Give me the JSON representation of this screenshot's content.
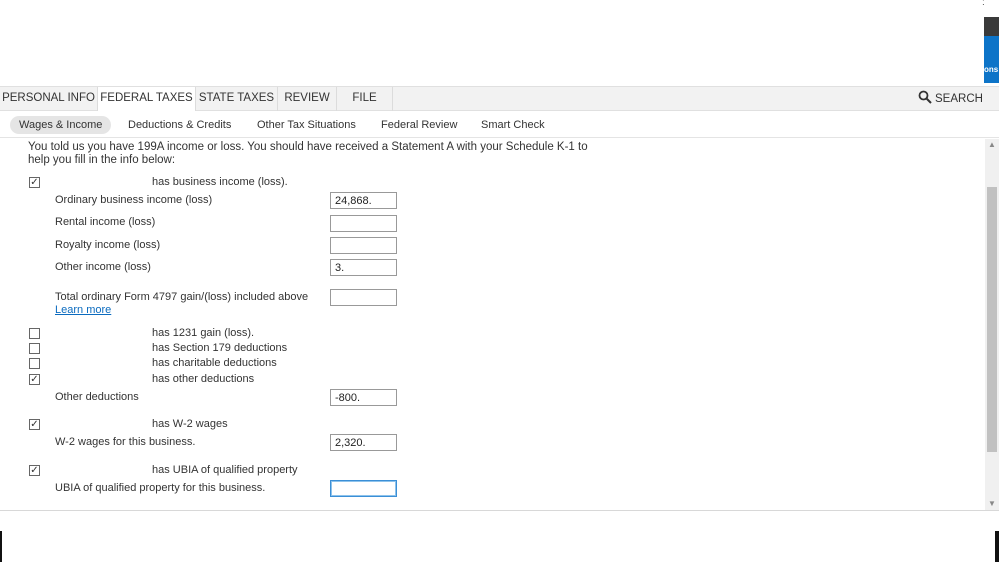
{
  "corner": {
    "dots": ":",
    "badge_text": "ons"
  },
  "nav": {
    "tabs": [
      {
        "label": "PERSONAL INFO"
      },
      {
        "label": "FEDERAL TAXES"
      },
      {
        "label": "STATE TAXES"
      },
      {
        "label": "REVIEW"
      },
      {
        "label": "FILE"
      }
    ],
    "active_tab": "FEDERAL TAXES",
    "search_label": "SEARCH",
    "search_icon": "magnifier-icon"
  },
  "subnav": {
    "tabs": [
      {
        "label": "Wages & Income"
      },
      {
        "label": "Deductions & Credits"
      },
      {
        "label": "Other Tax Situations"
      },
      {
        "label": "Federal Review"
      },
      {
        "label": "Smart Check"
      }
    ],
    "active_tab": "Wages & Income"
  },
  "form": {
    "intro": "You told us you have 199A income or loss. You should have received a Statement A with your Schedule K-1 to help you fill in the info below:",
    "business_income": {
      "label": "has business income (loss).",
      "checked": true
    },
    "ordinary_income": {
      "label": "Ordinary business income (loss)",
      "value": "24,868."
    },
    "rental_income": {
      "label": "Rental income (loss)",
      "value": ""
    },
    "royalty_income": {
      "label": "Royalty income (loss)",
      "value": ""
    },
    "other_income": {
      "label": "Other income (loss)",
      "value": "3."
    },
    "form4797": {
      "label": "Total ordinary Form 4797 gain/(loss) included above",
      "link": "Learn more",
      "value": ""
    },
    "gain_1231": {
      "label": "has 1231 gain (loss).",
      "checked": false
    },
    "section179": {
      "label": "has Section 179 deductions",
      "checked": false
    },
    "charitable": {
      "label": "has charitable deductions",
      "checked": false
    },
    "other_deductions_cb": {
      "label": "has other deductions",
      "checked": true
    },
    "other_deductions": {
      "label": "Other deductions",
      "value": "-800."
    },
    "w2_cb": {
      "label": "has W-2 wages",
      "checked": true
    },
    "w2_wages": {
      "label": "W-2 wages for this business.",
      "value": "2,320."
    },
    "ubia_cb": {
      "label": "has UBIA of qualified property",
      "checked": true
    },
    "ubia": {
      "label": "UBIA of qualified property for this business.",
      "value": ""
    }
  },
  "colors": {
    "accent_blue": "#0d74c8",
    "link": "#0b6bbf",
    "focus": "#3b8fd6"
  }
}
